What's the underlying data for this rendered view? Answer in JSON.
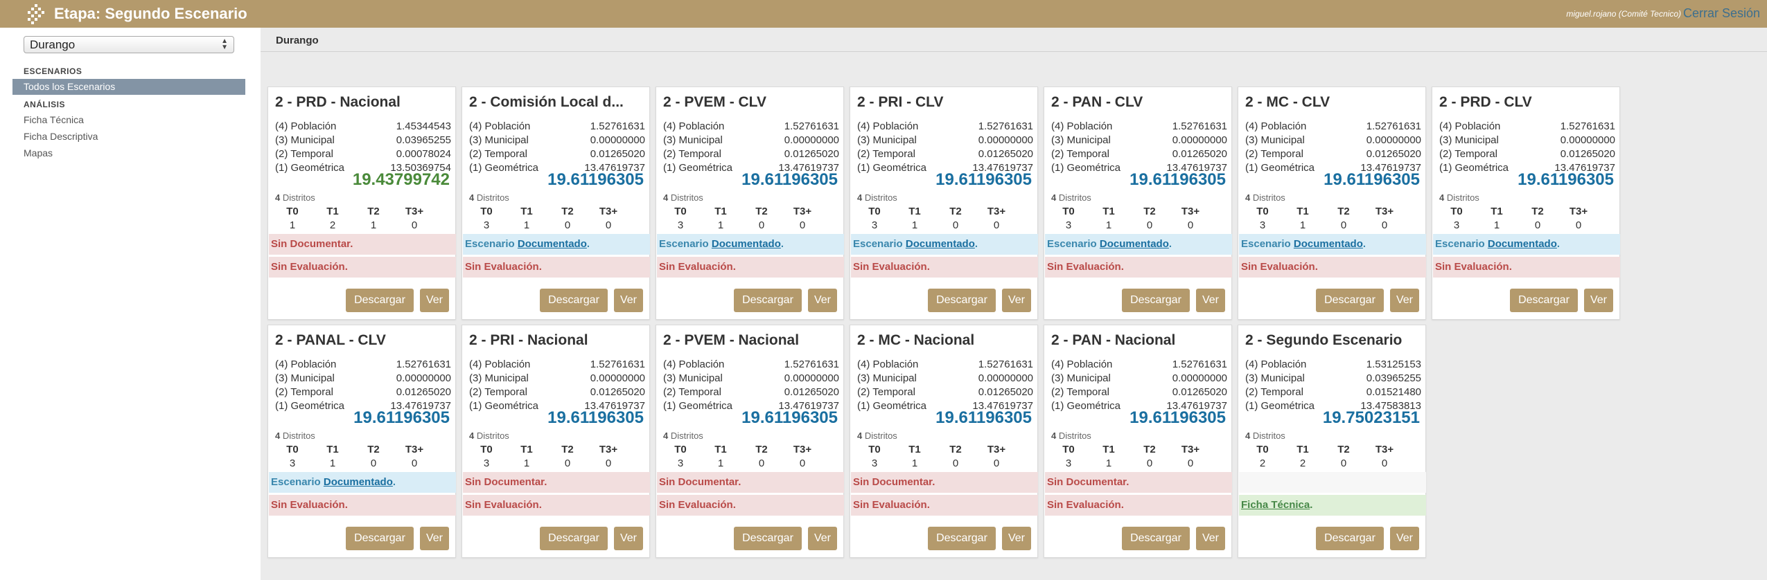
{
  "header": {
    "title": "Etapa: Segundo Escenario",
    "user": "miguel.rojano (Comité Tecnico)",
    "logout": "Cerrar Sesión",
    "logo_icon": "logo-grid-icon"
  },
  "sidebar": {
    "state_select": "Durango",
    "section_escenarios": "ESCENARIOS",
    "item_todos": "Todos los Escenarios",
    "section_analisis": "ANÁLISIS",
    "item_ficha_tecnica": "Ficha Técnica",
    "item_ficha_descriptiva": "Ficha Descriptiva",
    "item_mapas": "Mapas"
  },
  "main": {
    "breadcrumb": "Durango"
  },
  "labels": {
    "poblacion": "(4) Población",
    "municipal": "(3) Municipal",
    "temporal": "(2) Temporal",
    "geometrica": "(1) Geométrica",
    "distritos": "Distritos",
    "t0": "T0",
    "t1": "T1",
    "t2": "T2",
    "t3": "T3+",
    "descargar": "Descargar",
    "ver": "Ver",
    "sin_documentar": "Sin Documentar.",
    "sin_evaluacion": "Sin Evaluación.",
    "escenario_prefix": "Escenario ",
    "documentado": "Documentado",
    "ficha_tecnica": "Ficha Técnica",
    "period": "."
  },
  "cards": [
    {
      "title": "2 - PRD - Nacional",
      "poblacion": "1.45344543",
      "municipal": "0.03965255",
      "temporal": "0.00078024",
      "geometrica": "13.50369754",
      "total": "19.43799742",
      "total_color": "green",
      "distritos_count": "4",
      "t0": "1",
      "t1": "2",
      "t2": "1",
      "t3": "0",
      "doc": "sin",
      "eval": "sin"
    },
    {
      "title": "2 - Comisión Local d...",
      "poblacion": "1.52761631",
      "municipal": "0.00000000",
      "temporal": "0.01265020",
      "geometrica": "13.47619737",
      "total": "19.61196305",
      "total_color": "blue",
      "distritos_count": "4",
      "t0": "3",
      "t1": "1",
      "t2": "0",
      "t3": "0",
      "doc": "doc",
      "eval": "sin"
    },
    {
      "title": "2 - PVEM - CLV",
      "poblacion": "1.52761631",
      "municipal": "0.00000000",
      "temporal": "0.01265020",
      "geometrica": "13.47619737",
      "total": "19.61196305",
      "total_color": "blue",
      "distritos_count": "4",
      "t0": "3",
      "t1": "1",
      "t2": "0",
      "t3": "0",
      "doc": "doc",
      "eval": "sin"
    },
    {
      "title": "2 - PRI - CLV",
      "poblacion": "1.52761631",
      "municipal": "0.00000000",
      "temporal": "0.01265020",
      "geometrica": "13.47619737",
      "total": "19.61196305",
      "total_color": "blue",
      "distritos_count": "4",
      "t0": "3",
      "t1": "1",
      "t2": "0",
      "t3": "0",
      "doc": "doc",
      "eval": "sin"
    },
    {
      "title": "2 - PAN - CLV",
      "poblacion": "1.52761631",
      "municipal": "0.00000000",
      "temporal": "0.01265020",
      "geometrica": "13.47619737",
      "total": "19.61196305",
      "total_color": "blue",
      "distritos_count": "4",
      "t0": "3",
      "t1": "1",
      "t2": "0",
      "t3": "0",
      "doc": "doc",
      "eval": "sin"
    },
    {
      "title": "2 - MC - CLV",
      "poblacion": "1.52761631",
      "municipal": "0.00000000",
      "temporal": "0.01265020",
      "geometrica": "13.47619737",
      "total": "19.61196305",
      "total_color": "blue",
      "distritos_count": "4",
      "t0": "3",
      "t1": "1",
      "t2": "0",
      "t3": "0",
      "doc": "doc",
      "eval": "sin"
    },
    {
      "title": "2 - PRD - CLV",
      "poblacion": "1.52761631",
      "municipal": "0.00000000",
      "temporal": "0.01265020",
      "geometrica": "13.47619737",
      "total": "19.61196305",
      "total_color": "blue",
      "distritos_count": "4",
      "t0": "3",
      "t1": "1",
      "t2": "0",
      "t3": "0",
      "doc": "doc",
      "eval": "sin"
    },
    {
      "title": "2 - PANAL - CLV",
      "poblacion": "1.52761631",
      "municipal": "0.00000000",
      "temporal": "0.01265020",
      "geometrica": "13.47619737",
      "total": "19.61196305",
      "total_color": "blue",
      "distritos_count": "4",
      "t0": "3",
      "t1": "1",
      "t2": "0",
      "t3": "0",
      "doc": "doc",
      "eval": "sin"
    },
    {
      "title": "2 - PRI - Nacional",
      "poblacion": "1.52761631",
      "municipal": "0.00000000",
      "temporal": "0.01265020",
      "geometrica": "13.47619737",
      "total": "19.61196305",
      "total_color": "blue",
      "distritos_count": "4",
      "t0": "3",
      "t1": "1",
      "t2": "0",
      "t3": "0",
      "doc": "sin",
      "eval": "sin"
    },
    {
      "title": "2 - PVEM - Nacional",
      "poblacion": "1.52761631",
      "municipal": "0.00000000",
      "temporal": "0.01265020",
      "geometrica": "13.47619737",
      "total": "19.61196305",
      "total_color": "blue",
      "distritos_count": "4",
      "t0": "3",
      "t1": "1",
      "t2": "0",
      "t3": "0",
      "doc": "sin",
      "eval": "sin"
    },
    {
      "title": "2 - MC - Nacional",
      "poblacion": "1.52761631",
      "municipal": "0.00000000",
      "temporal": "0.01265020",
      "geometrica": "13.47619737",
      "total": "19.61196305",
      "total_color": "blue",
      "distritos_count": "4",
      "t0": "3",
      "t1": "1",
      "t2": "0",
      "t3": "0",
      "doc": "sin",
      "eval": "sin"
    },
    {
      "title": "2 - PAN - Nacional",
      "poblacion": "1.52761631",
      "municipal": "0.00000000",
      "temporal": "0.01265020",
      "geometrica": "13.47619737",
      "total": "19.61196305",
      "total_color": "blue",
      "distritos_count": "4",
      "t0": "3",
      "t1": "1",
      "t2": "0",
      "t3": "0",
      "doc": "sin",
      "eval": "sin"
    },
    {
      "title": "2 - Segundo Escenario",
      "poblacion": "1.53125153",
      "municipal": "0.03965255",
      "temporal": "0.01521480",
      "geometrica": "13.47583813",
      "total": "19.75023151",
      "total_color": "blue",
      "distritos_count": "4",
      "t0": "2",
      "t1": "2",
      "t2": "0",
      "t3": "0",
      "doc": "none",
      "eval": "ficha"
    }
  ]
}
